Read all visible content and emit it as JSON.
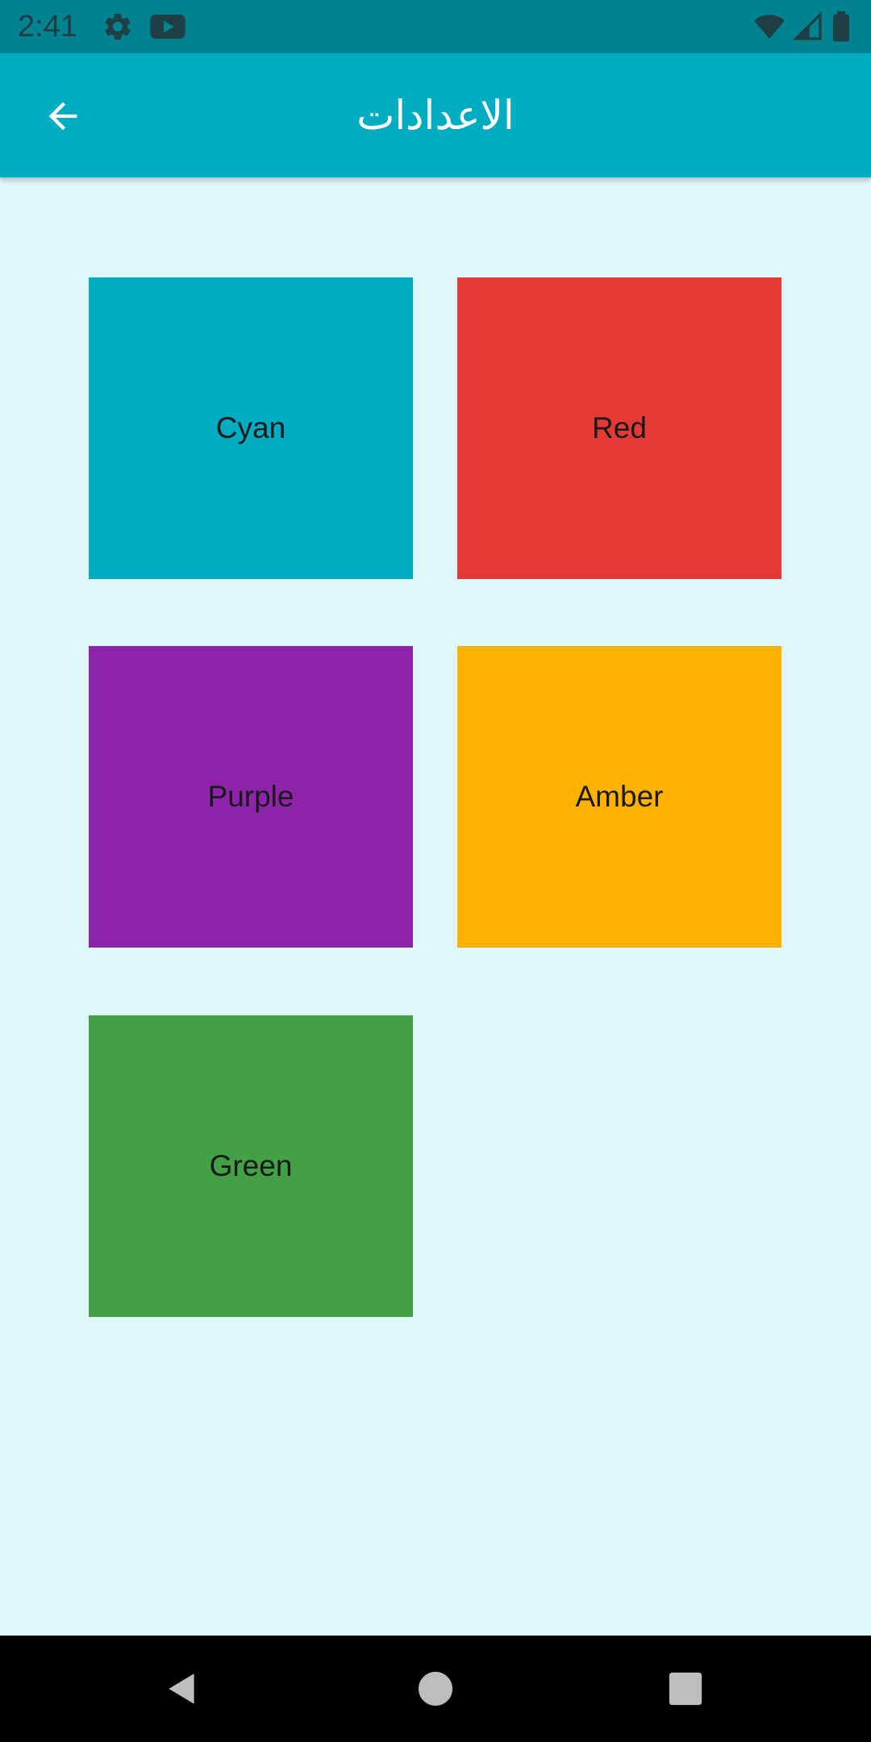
{
  "status_bar": {
    "time": "2:41",
    "icons_left": [
      "gear-icon",
      "youtube-icon"
    ],
    "icons_right": [
      "wifi-icon",
      "cell-signal-icon",
      "battery-icon"
    ]
  },
  "app_bar": {
    "title": "الاعدادات",
    "back_icon": "arrow-back-icon",
    "background": "#00ACC1"
  },
  "tiles": [
    {
      "label": "Cyan",
      "color": "#00ACC1"
    },
    {
      "label": "Red",
      "color": "#E53935"
    },
    {
      "label": "Purple",
      "color": "#8E24AA"
    },
    {
      "label": "Amber",
      "color": "#FFB300"
    },
    {
      "label": "Green",
      "color": "#43A047"
    }
  ],
  "nav_bar": {
    "buttons": [
      "back-triangle-icon",
      "home-circle-icon",
      "recents-square-icon"
    ]
  },
  "colors": {
    "page_background": "#E0F7FA",
    "status_bar": "#00838F"
  }
}
